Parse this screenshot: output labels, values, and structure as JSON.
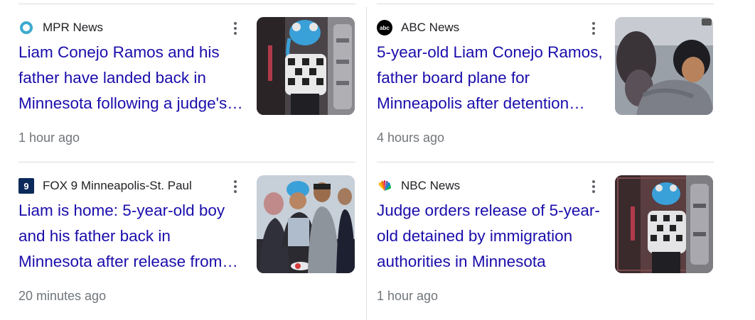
{
  "cards": [
    {
      "source": "MPR News",
      "source_icon": "mpr-circle-logo-icon",
      "headline": "Liam Conejo Ramos and his father have landed back in Minnesota following a judge's ruling",
      "time": "1 hour ago",
      "thumb": "boy-blue-hat-photo"
    },
    {
      "source": "ABC News",
      "source_icon": "abc-logo-icon",
      "headline": "5-year-old Liam Conejo Ramos, father board plane for Minneapolis after detention ruling",
      "time": "4 hours ago",
      "thumb": "father-hugging-boy-photo"
    },
    {
      "source": "FOX 9 Minneapolis-St. Paul",
      "source_icon": "fox9-logo-icon",
      "headline": "Liam is home: 5-year-old boy and his father back in Minnesota after release from detention",
      "time": "20 minutes ago",
      "thumb": "family-group-photo"
    },
    {
      "source": "NBC News",
      "source_icon": "nbc-peacock-logo-icon",
      "headline": "Judge orders release of 5-year-old detained by immigration authorities in Minnesota",
      "time": "1 hour ago",
      "thumb": "boy-blue-hat-photo-2"
    }
  ],
  "colors": {
    "headline": "#1a0dab",
    "source": "#202124",
    "time": "#70757a",
    "divider": "#dadce0",
    "mpr": "#3dabcf",
    "fox9": "#0b2a5b"
  }
}
